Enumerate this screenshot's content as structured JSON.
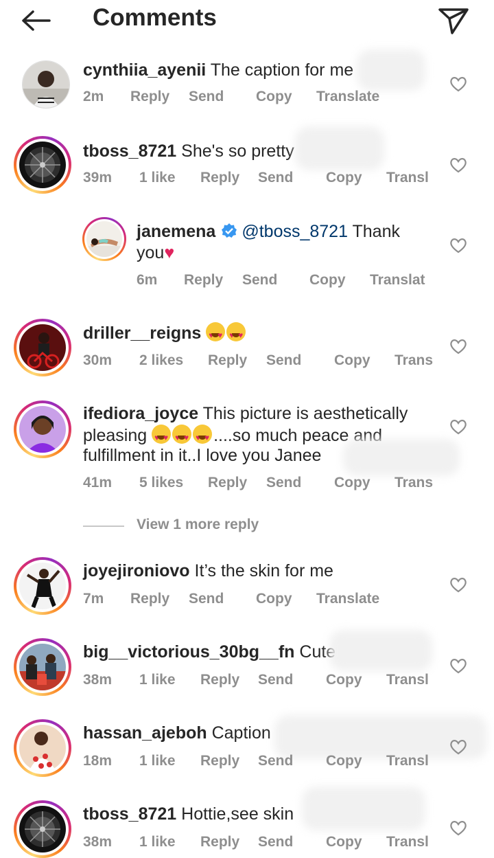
{
  "header": {
    "title": "Comments"
  },
  "comments": [
    {
      "username": "cynthiia_ayenii",
      "text": "The caption for me",
      "time": "2m",
      "likes": "",
      "actions": [
        "Reply",
        "Send",
        "Copy",
        "Translate"
      ]
    },
    {
      "username": "tboss_8721",
      "text": "She's so pretty",
      "time": "39m",
      "likes": "1 like",
      "actions": [
        "Reply",
        "Send",
        "Copy",
        "Transl"
      ]
    },
    {
      "username": "janemena",
      "mention": "@tboss_8721",
      "text": "Thank",
      "text2": "you",
      "time": "6m",
      "likes": "",
      "actions": [
        "Reply",
        "Send",
        "Copy",
        "Translat"
      ]
    },
    {
      "username": "driller__reigns",
      "text": "",
      "time": "30m",
      "likes": "2 likes",
      "actions": [
        "Reply",
        "Send",
        "Copy",
        "Trans"
      ]
    },
    {
      "username": "ifediora_joyce",
      "text": "This picture is aesthetically",
      "text2": "pleasing",
      "text2b": "....so much peace and",
      "text3": "fulfillment in it..I love you Janee",
      "time": "41m",
      "likes": "5 likes",
      "actions": [
        "Reply",
        "Send",
        "Copy",
        "Trans"
      ]
    },
    {
      "username": "joyejironiovo",
      "text": "It’s the skin for me",
      "time": "7m",
      "likes": "",
      "actions": [
        "Reply",
        "Send",
        "Copy",
        "Translate"
      ]
    },
    {
      "username": "big__victorious_30bg__fn",
      "text": "Cute",
      "time": "38m",
      "likes": "1 like",
      "actions": [
        "Reply",
        "Send",
        "Copy",
        "Transl"
      ]
    },
    {
      "username": "hassan_ajeboh",
      "text": "Caption",
      "time": "18m",
      "likes": "1 like",
      "actions": [
        "Reply",
        "Send",
        "Copy",
        "Transl"
      ]
    },
    {
      "username": "tboss_8721",
      "text": "Hottie,see skin",
      "time": "38m",
      "likes": "1 like",
      "actions": [
        "Reply",
        "Send",
        "Copy",
        "Transl"
      ]
    }
  ],
  "view_more": "View 1 more reply",
  "icons": {
    "back": "arrow-left-icon",
    "send": "paper-plane-icon",
    "like": "heart-outline-icon",
    "verified": "verified-badge-icon"
  },
  "colors": {
    "text": "#262626",
    "meta": "#8e8e8e",
    "mention": "#00376b",
    "verified": "#3897f0",
    "heart": "#e0245e"
  }
}
